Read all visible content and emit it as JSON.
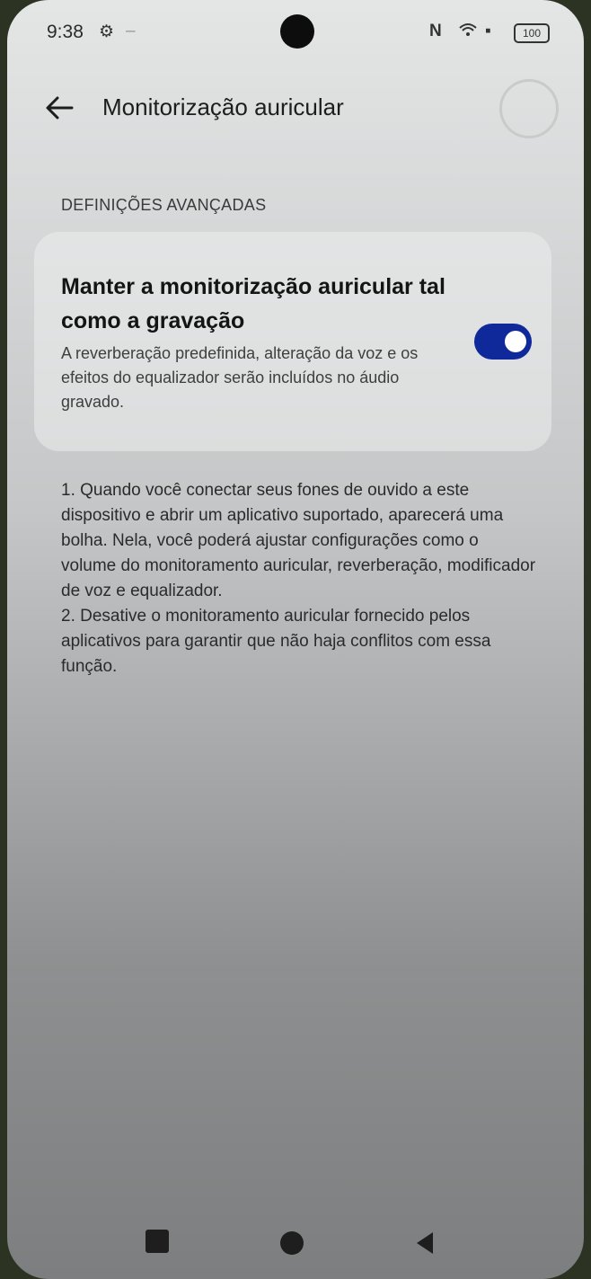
{
  "status_bar": {
    "time": "9:38",
    "battery": "100"
  },
  "header": {
    "title": "Monitorização auricular"
  },
  "section": {
    "label": "DEFINIÇÕES AVANÇADAS"
  },
  "option": {
    "title": "Manter a monitorização auricular tal como a gravação",
    "description": "A reverberação predefinida, alteração da voz e os efeitos do equalizador serão incluídos no áudio gravado.",
    "enabled": true
  },
  "notes": {
    "item1": "1. Quando você conectar seus fones de ouvido a este dispositivo e abrir um aplicativo suportado, aparecerá uma bolha. Nela, você poderá ajustar configurações como o volume do monitoramento auricular, reverberação, modificador de voz e equalizador.",
    "item2": "2. Desative o monitoramento auricular fornecido pelos aplicativos para garantir que não haja conflitos com essa função."
  },
  "colors": {
    "toggle_on": "#10299a"
  },
  "icons": [
    "back-arrow-icon",
    "gear-icon",
    "nfc-icon",
    "wifi-icon",
    "battery-icon",
    "recents-icon",
    "home-icon",
    "back-icon"
  ]
}
